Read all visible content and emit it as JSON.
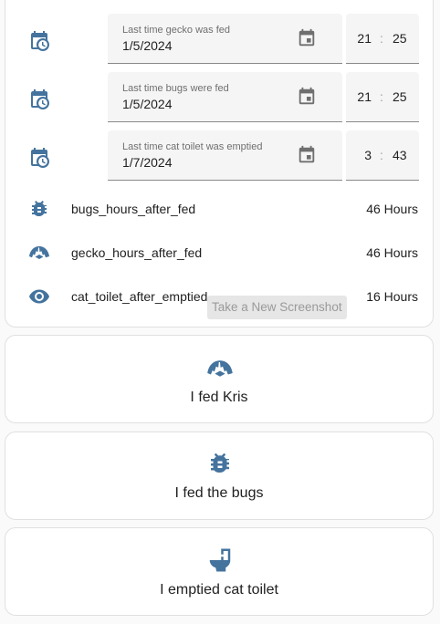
{
  "colors": {
    "accent": "#44739e",
    "field_bg": "#f5f5f5",
    "text": "#212121"
  },
  "datetime_rows": [
    {
      "icon": "calendar-clock-icon",
      "label": "Last time gecko was fed",
      "date": "1/5/2024",
      "hour": "21",
      "minute": "25"
    },
    {
      "icon": "calendar-clock-icon",
      "label": "Last time bugs were fed",
      "date": "1/5/2024",
      "hour": "21",
      "minute": "25"
    },
    {
      "icon": "calendar-clock-icon",
      "label": "Last time cat toilet was emptied",
      "date": "1/7/2024",
      "hour": "3",
      "minute": "43"
    }
  ],
  "time_separator": ":",
  "sensors": [
    {
      "icon": "bug-icon",
      "name": "bugs_hours_after_fed",
      "value": "46 Hours"
    },
    {
      "icon": "gecko-icon",
      "name": "gecko_hours_after_fed",
      "value": "46 Hours"
    },
    {
      "icon": "eye-icon",
      "name": "cat_toilet_after_emptied",
      "value": "16 Hours"
    }
  ],
  "tooltip": "Take a New Screenshot",
  "buttons": [
    {
      "icon": "gecko-icon",
      "label": "I fed Kris"
    },
    {
      "icon": "bug-icon",
      "label": "I fed the bugs"
    },
    {
      "icon": "toilet-icon",
      "label": "I emptied cat toilet"
    }
  ]
}
